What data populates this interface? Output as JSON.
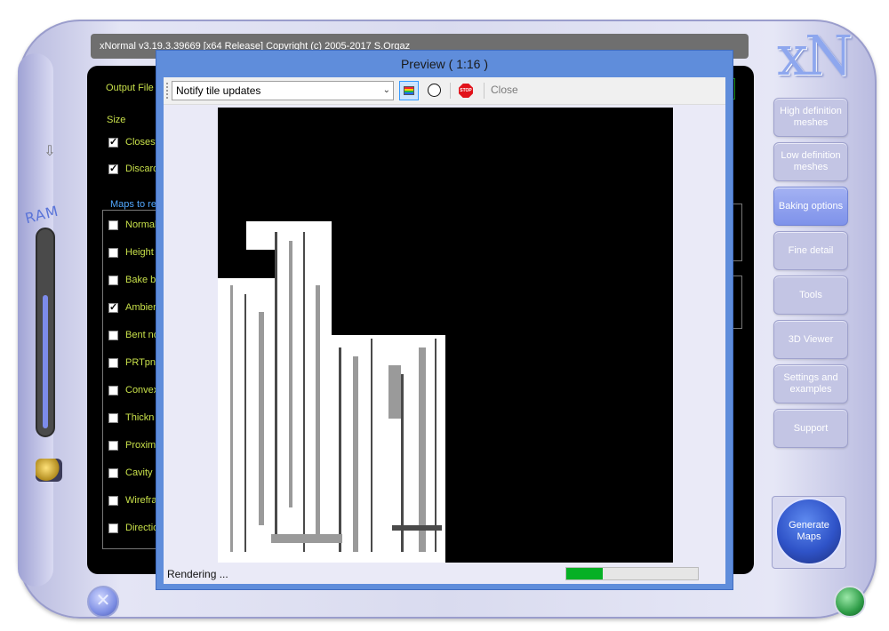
{
  "main_window": {
    "title": "xNormal v3.19.3.39669 [x64 Release] Copyright (c) 2005-2017 S.Orgaz",
    "ram_label": "RAM",
    "logo": "xN",
    "output_file_label": "Output File",
    "size_label": "Size",
    "options": [
      {
        "label": "Closest h",
        "checked": true
      },
      {
        "label": "Discard",
        "checked": true
      }
    ],
    "maps_group_label": "Maps to re",
    "maps": [
      {
        "label": "Normal",
        "checked": false
      },
      {
        "label": "Height",
        "checked": false
      },
      {
        "label": "Bake b",
        "checked": false
      },
      {
        "label": "Ambien",
        "checked": true
      },
      {
        "label": "Bent no",
        "checked": false
      },
      {
        "label": "PRTpn",
        "checked": false
      },
      {
        "label": "Convex",
        "checked": false
      },
      {
        "label": "Thickn",
        "checked": false
      },
      {
        "label": "Proximit",
        "checked": false
      },
      {
        "label": "Cavity n",
        "checked": false
      },
      {
        "label": "Wirefra",
        "checked": false
      },
      {
        "label": "Directio",
        "checked": false
      }
    ]
  },
  "nav": [
    {
      "label": "High definition meshes",
      "active": false
    },
    {
      "label": "Low definition meshes",
      "active": false
    },
    {
      "label": "Baking options",
      "active": true
    },
    {
      "label": "Fine detail",
      "active": false
    },
    {
      "label": "Tools",
      "active": false
    },
    {
      "label": "3D Viewer",
      "active": false
    },
    {
      "label": "Settings and examples",
      "active": false
    },
    {
      "label": "Support",
      "active": false
    }
  ],
  "generate_button": "Generate Maps",
  "preview": {
    "title": "Preview ( 1:16 )",
    "dropdown_value": "Notify tile updates",
    "close_label": "Close",
    "stop_icon_text": "STOP",
    "status_text": "Rendering ...",
    "progress": 0.28
  },
  "colors": {
    "dialog_border": "#5f8ddb",
    "progress": "#06b025",
    "label_green": "#c8e04a",
    "label_blue": "#52a8ff",
    "active_nav": "#7e92ea"
  },
  "icons": [
    "down-arrow-icon",
    "plug-icon",
    "color-channels-icon",
    "circle-icon",
    "stop-icon",
    "chevron-down-icon"
  ]
}
